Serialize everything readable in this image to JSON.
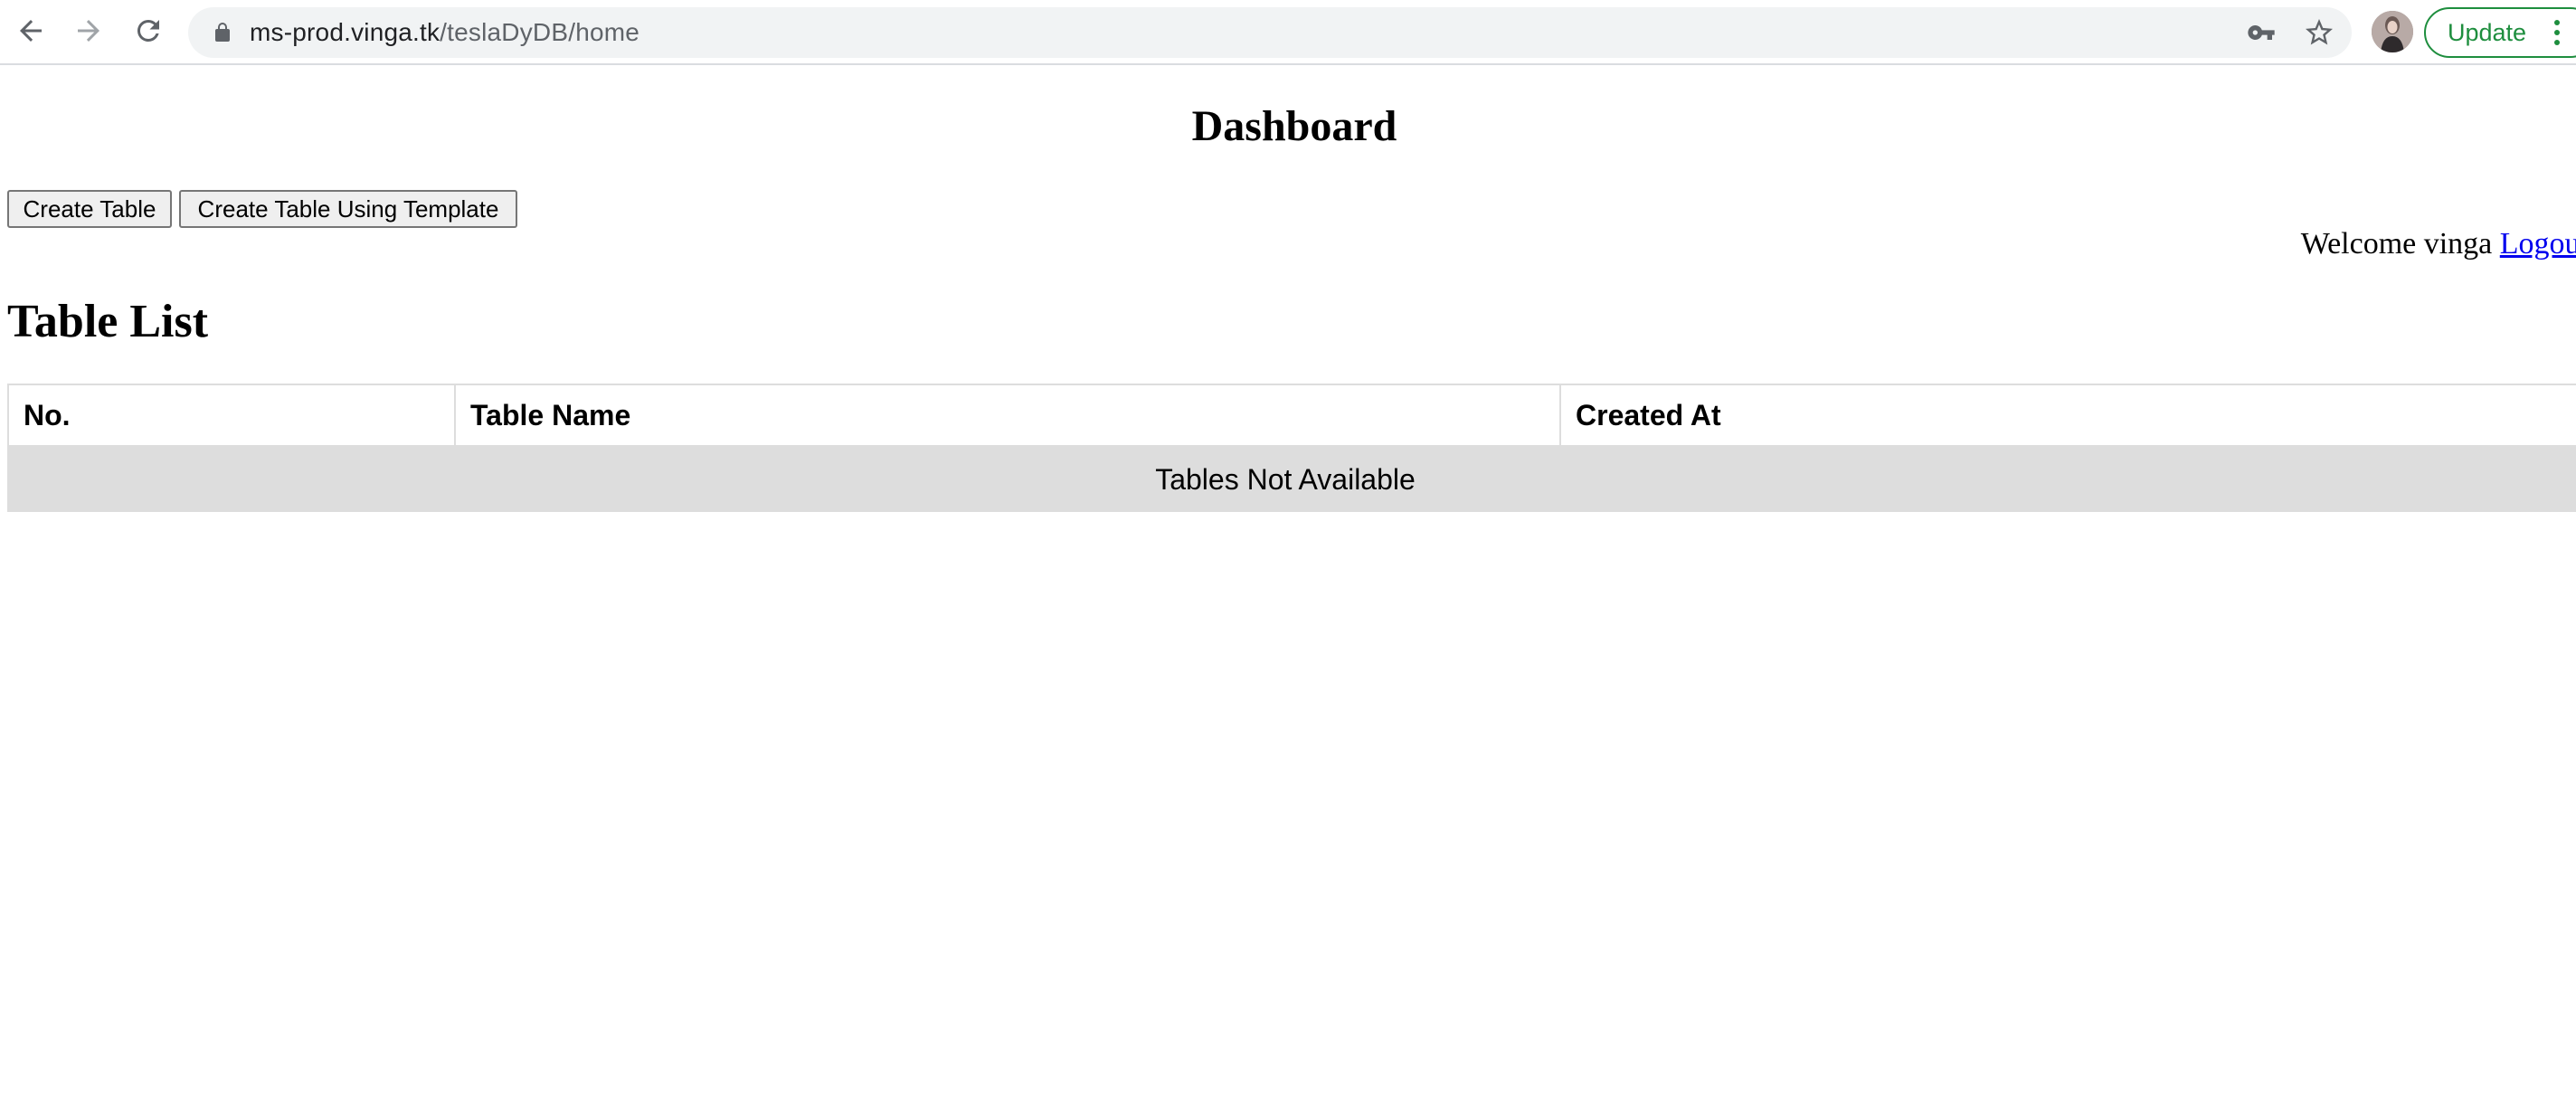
{
  "browser": {
    "url_host": "ms-prod.vinga.tk",
    "url_path": "/teslaDyDB/home",
    "update_label": "Update",
    "icons": {
      "back": "back-arrow-icon",
      "forward": "forward-arrow-icon",
      "reload": "reload-icon",
      "lock": "lock-icon",
      "key": "key-icon",
      "bookmark": "star-icon",
      "menu": "kebab-menu-icon"
    }
  },
  "page": {
    "title": "Dashboard",
    "buttons": {
      "create_table": "Create Table",
      "create_table_template": "Create Table Using Template"
    },
    "welcome_text": "Welcome vinga",
    "logout_label": "Logout",
    "section_title": "Table List",
    "table": {
      "columns": [
        "No.",
        "Table Name",
        "Created At"
      ],
      "empty_message": "Tables Not Available"
    }
  },
  "colors": {
    "update_green": "#1e8e3e",
    "link_blue": "#0000ee",
    "table_border": "#dddddd",
    "empty_row_bg": "#dddddd"
  }
}
